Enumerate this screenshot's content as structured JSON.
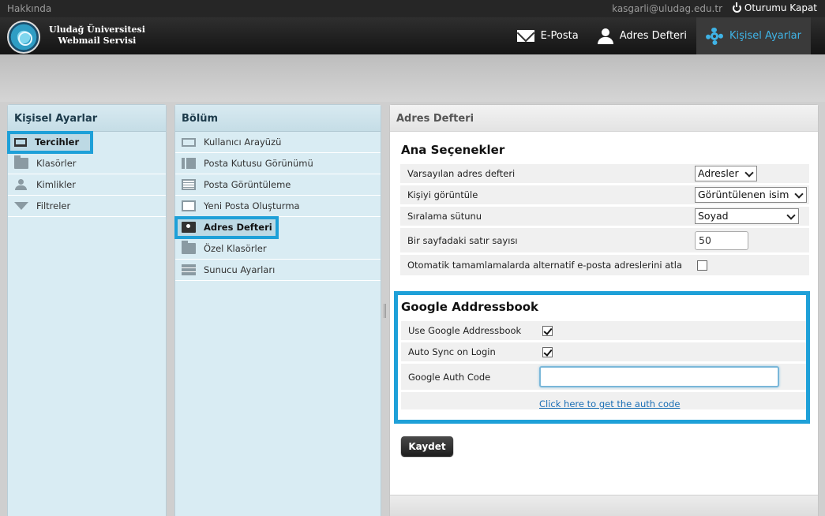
{
  "topbar": {
    "about": "Hakkında",
    "user_email": "kasgarli@uludag.edu.tr",
    "logout": "Oturumu Kapat"
  },
  "brand": {
    "line1": "Uludağ Üniversitesi",
    "line2": "Webmail Servisi"
  },
  "nav": [
    {
      "label": "E-Posta",
      "icon": "envelope-icon"
    },
    {
      "label": "Adres Defteri",
      "icon": "user-icon"
    },
    {
      "label": "Kişisel Ayarlar",
      "icon": "gear-icon",
      "active": true
    }
  ],
  "settings_panel": {
    "title": "Kişisel Ayarlar",
    "items": [
      {
        "label": "Tercihler",
        "icon": "laptop-icon",
        "selected": true
      },
      {
        "label": "Klasörler",
        "icon": "folder-icon"
      },
      {
        "label": "Kimlikler",
        "icon": "person-icon"
      },
      {
        "label": "Filtreler",
        "icon": "filter-icon"
      }
    ]
  },
  "section_panel": {
    "title": "Bölüm",
    "items": [
      {
        "label": "Kullanıcı Arayüzü",
        "icon": "monitor-icon"
      },
      {
        "label": "Posta Kutusu Görünümü",
        "icon": "layout-icon"
      },
      {
        "label": "Posta Görüntüleme",
        "icon": "document-icon"
      },
      {
        "label": "Yeni Posta Oluşturma",
        "icon": "new-mail-icon"
      },
      {
        "label": "Adres Defteri",
        "icon": "address-book-icon",
        "selected": true
      },
      {
        "label": "Özel Klasörler",
        "icon": "folder-icon"
      },
      {
        "label": "Sunucu Ayarları",
        "icon": "server-icon"
      }
    ]
  },
  "main": {
    "title": "Adres Defteri",
    "main_options": {
      "heading": "Ana Seçenekler",
      "default_book_label": "Varsayılan adres defteri",
      "default_book_value": "Adresler",
      "show_contact_label": "Kişiyi görüntüle",
      "show_contact_value": "Görüntülenen isim",
      "sort_column_label": "Sıralama sütunu",
      "sort_column_value": "Soyad",
      "rows_per_page_label": "Bir sayfadaki satır sayısı",
      "rows_per_page_value": "50",
      "skip_alt_label": "Otomatik tamamlamalarda alternatif e-posta adreslerini atla",
      "skip_alt_checked": false
    },
    "google": {
      "heading": "Google Addressbook",
      "use_label": "Use Google Addressbook",
      "use_checked": true,
      "sync_label": "Auto Sync on Login",
      "sync_checked": true,
      "auth_code_label": "Google Auth Code",
      "auth_code_value": "",
      "auth_link": "Click here to get the auth code"
    },
    "save_button": "Kaydet"
  },
  "colors": {
    "accent": "#1ea0d8",
    "active_nav": "#3fb3e6",
    "panel_bg": "#d9ecf3"
  }
}
